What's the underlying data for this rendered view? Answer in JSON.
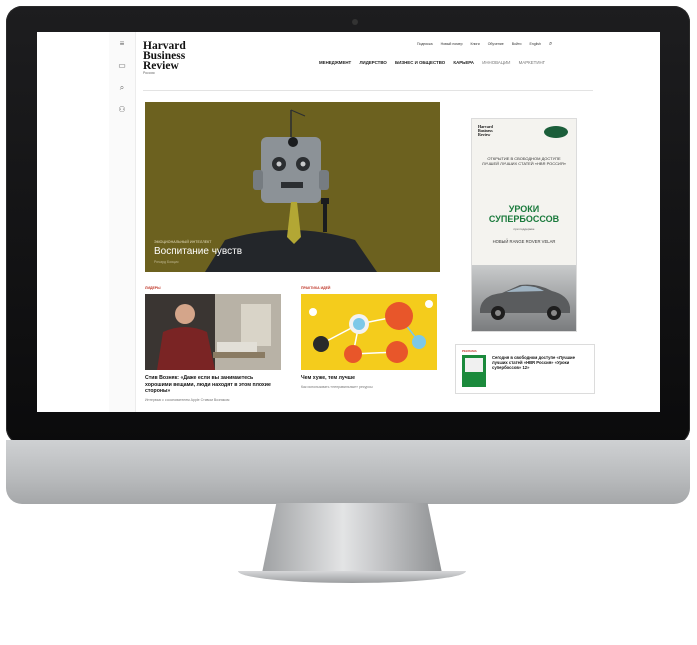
{
  "site": {
    "logo": [
      "Harvard",
      "Business",
      "Review"
    ],
    "logo_sub": "Россия"
  },
  "topbar": {
    "links": [
      "Подписка",
      "Новый номер",
      "Книги",
      "Обучение",
      "Войти",
      "English"
    ]
  },
  "nav": {
    "items": [
      {
        "label": "МЕНЕДЖМЕНТ",
        "active": true
      },
      {
        "label": "ЛИДЕРСТВО",
        "active": true
      },
      {
        "label": "БИЗНЕС И ОБЩЕСТВО",
        "active": true
      },
      {
        "label": "КАРЬЕРА",
        "active": true
      },
      {
        "label": "ИННОВАЦИИ",
        "active": false
      },
      {
        "label": "МАРКЕТИНГ",
        "active": false
      }
    ]
  },
  "rail": {
    "icons": [
      "menu-icon",
      "bookmark-icon",
      "search-icon",
      "user-icon"
    ],
    "glyphs": [
      "≡",
      "▭",
      "⌕",
      "⚇"
    ]
  },
  "hero": {
    "kicker": "ЭМОЦИОНАЛЬНЫЙ ИНТЕЛЛЕКТ",
    "title": "Воспитание чувств",
    "byline": "Ричард Бояцис"
  },
  "cards": [
    {
      "tag": "ЛИДЕРЫ",
      "headline": "Стив Возняк: «Даже если вы занимаетесь хорошими вещами, люди находят в этом плохие стороны»",
      "dek": "Интервью с сооснователем Apple Стивом Возняком"
    },
    {
      "tag": "ПРАКТИКА ИДЕЙ",
      "headline": "Чем хуже, тем лучше",
      "dek": "Как использовать «неправильные» ресурсы"
    }
  ],
  "ad": {
    "brand": [
      "Harvard",
      "Business",
      "Review"
    ],
    "copy1": "ОТКРЫТИЕ В СВОБОДНОМ ДОСТУПЕ ЛУЧШЕЙ ЛУЧШИХ СТАТЕЙ «HBR РОССИЯ»",
    "copy2": "УРОКИ СУПЕРБОССОВ",
    "copy3": "при поддержке",
    "copy4": "НОВЫЙ RANGE ROVER VELAR"
  },
  "promo": {
    "tag": "РЕКЛАМА",
    "text": "Сегодня в свободном доступе «Лучшие лучших статей «HBR Россия» «Уроки супербоссов» 12»"
  },
  "colors": {
    "hero_bg": "#6c611f",
    "accent_red": "#c0392b",
    "ad_green": "#1a7a3c"
  }
}
